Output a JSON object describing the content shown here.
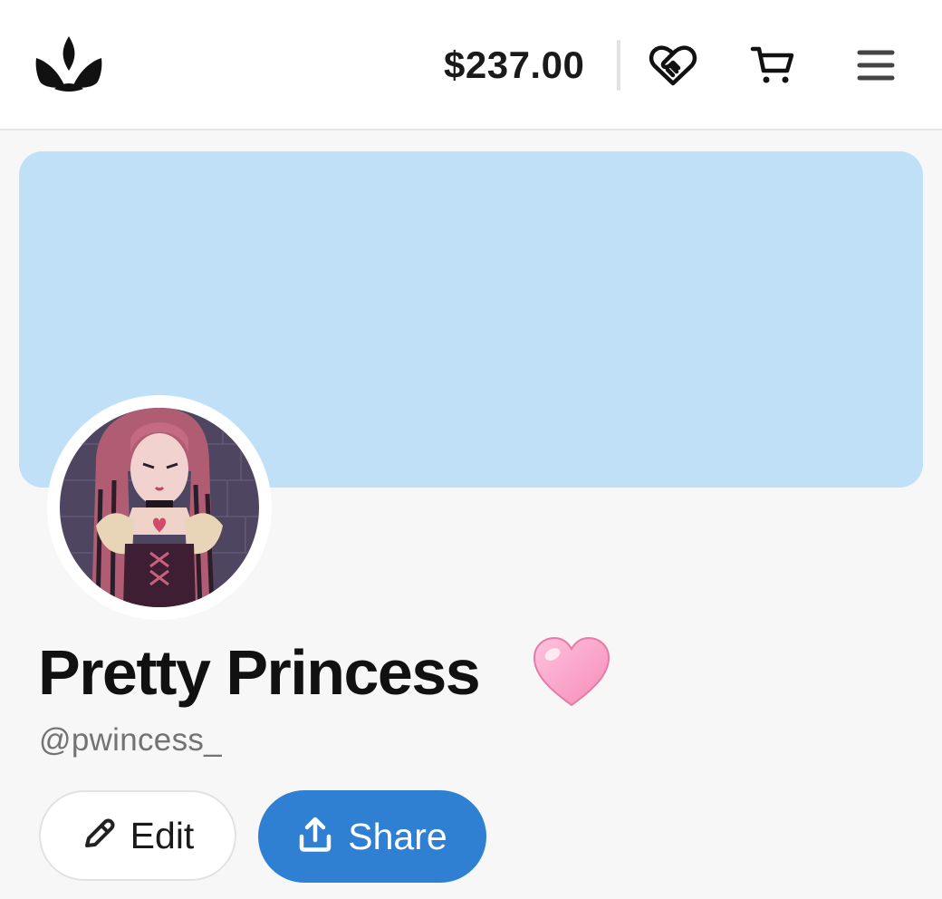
{
  "header": {
    "logo_icon": "crown-logo-icon",
    "balance": "$237.00",
    "tip_icon": "heart-handshake-icon",
    "cart_icon": "cart-icon",
    "menu_icon": "hamburger-menu-icon"
  },
  "profile": {
    "banner_color": "#bfe0f6",
    "avatar_alt": "anime-girl-avatar",
    "display_name": "Pretty Princess",
    "name_emoji": "pink-heart-emoji",
    "handle": "@pwincess_"
  },
  "actions": {
    "edit_label": "Edit",
    "edit_icon": "pencil-icon",
    "share_label": "Share",
    "share_icon": "share-upload-icon",
    "accent_color": "#2f7fd3"
  }
}
